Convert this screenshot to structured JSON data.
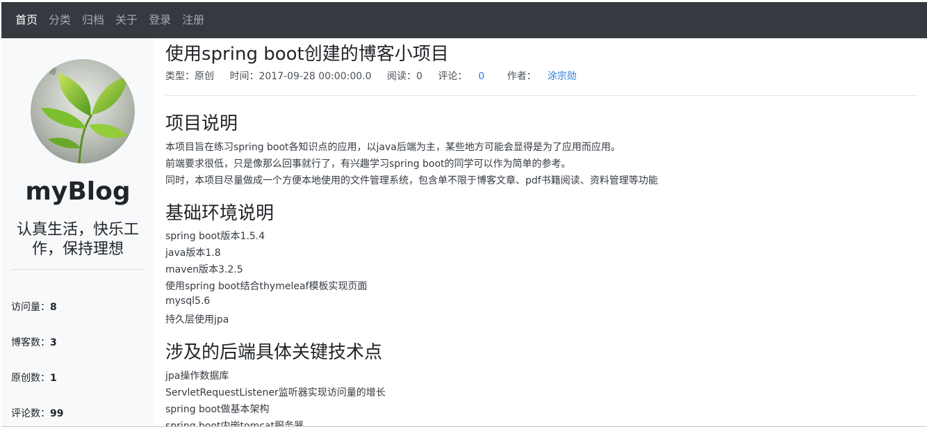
{
  "nav": {
    "items": [
      "首页",
      "分类",
      "归档",
      "关于",
      "登录",
      "注册"
    ]
  },
  "sidebar": {
    "avatar_icon": "leaf-avatar",
    "site_title": "myBlog",
    "motto": "认真生活，快乐工作，保持理想",
    "stats": [
      {
        "label": "访问量：",
        "value": "8"
      },
      {
        "label": "博客数：",
        "value": "3"
      },
      {
        "label": "原创数：",
        "value": "1"
      },
      {
        "label": "评论数：",
        "value": "99"
      }
    ]
  },
  "post": {
    "title": "使用spring boot创建的博客小项目",
    "meta": {
      "type": "类型：原创",
      "time": "时间：2017-09-28 00:00:00.0",
      "reads": "阅读：0",
      "comments_label": "评论：",
      "comments_value": "0",
      "author_label": "作者：",
      "author_value": "涂宗勋"
    },
    "sections": [
      {
        "heading": "项目说明",
        "lines": [
          "本项目旨在练习spring boot各知识点的应用，以java后端为主，某些地方可能会显得是为了应用而应用。",
          "前端要求很低，只是像那么回事就行了，有兴趣学习spring boot的同学可以作为简单的参考。",
          "同时，本项目尽量做成一个方便本地使用的文件管理系统，包含单不限于博客文章、pdf书籍阅读、资料管理等功能"
        ]
      },
      {
        "heading": "基础环境说明",
        "lines": [
          "spring boot版本1.5.4",
          "java版本1.8",
          "maven版本3.2.5",
          "使用spring boot结合thymeleaf模板实现页面",
          "mysql5.6",
          "持久层使用jpa"
        ]
      },
      {
        "heading": "涉及的后端具体关键技术点",
        "lines": [
          "jpa操作数据库",
          "ServletRequestListener监听器实现访问量的增长",
          "spring boot做基本架构",
          "spring boot内嵌tomcat服务器"
        ]
      }
    ]
  },
  "colors": {
    "navbar": "#343a40",
    "sidebar": "#f8f9fa",
    "link": "#2c7be5"
  }
}
